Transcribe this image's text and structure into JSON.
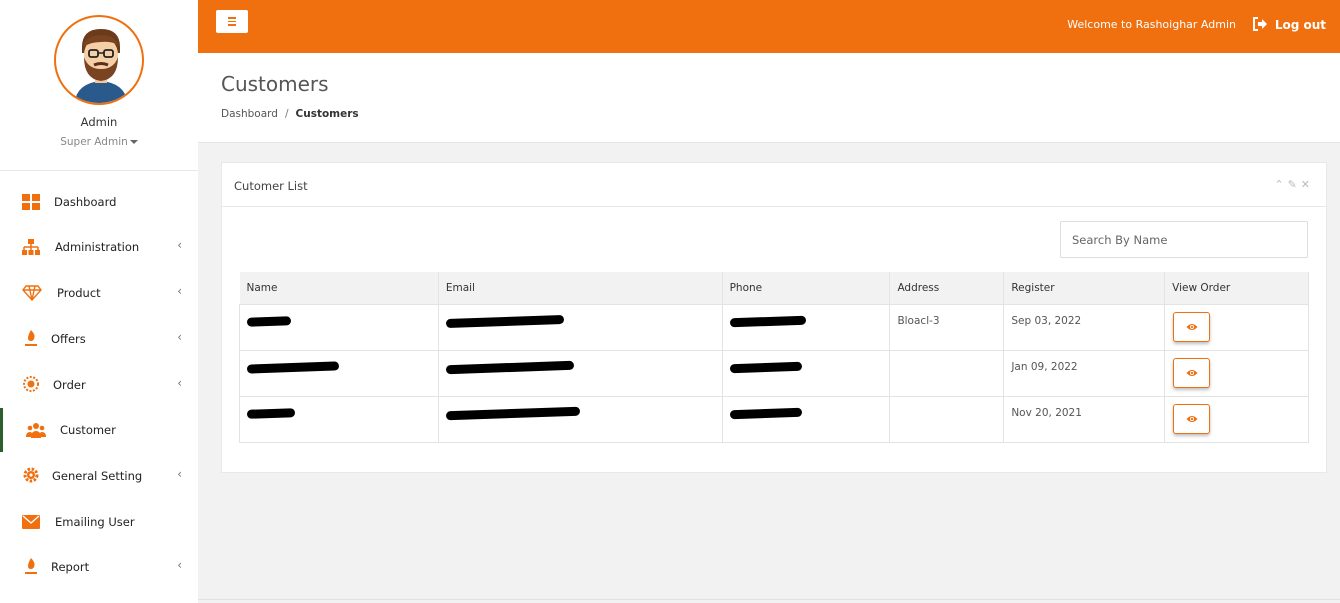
{
  "profile": {
    "name": "Admin",
    "role": "Super Admin"
  },
  "nav": {
    "items": [
      {
        "label": "Dashboard",
        "icon": "dashboard-icon",
        "has_chevron": false
      },
      {
        "label": "Administration",
        "icon": "sitemap-icon",
        "has_chevron": true
      },
      {
        "label": "Product",
        "icon": "diamond-icon",
        "has_chevron": true
      },
      {
        "label": "Offers",
        "icon": "fire-icon",
        "has_chevron": true
      },
      {
        "label": "Order",
        "icon": "burst-icon",
        "has_chevron": true
      },
      {
        "label": "Customer",
        "icon": "users-icon",
        "has_chevron": false,
        "active": true
      },
      {
        "label": "General Setting",
        "icon": "gear-icon",
        "has_chevron": true
      },
      {
        "label": "Emailing User",
        "icon": "envelope-icon",
        "has_chevron": false
      },
      {
        "label": "Report",
        "icon": "fire-icon",
        "has_chevron": true
      }
    ],
    "chevron": "‹"
  },
  "topbar": {
    "welcome": "Welcome to Rashoighar Admin",
    "logout": "Log out"
  },
  "page": {
    "title": "Customers",
    "breadcrumb": {
      "home": "Dashboard",
      "sep": "/",
      "current": "Customers"
    }
  },
  "panel": {
    "title": "Cutomer List",
    "tools": "⌃ ✎ ✕",
    "search_placeholder": "Search By Name",
    "columns": [
      "Name",
      "Email",
      "Phone",
      "Address",
      "Register",
      "View Order"
    ],
    "rows": [
      {
        "address": "Bloacl-3",
        "register": "Sep 03, 2022"
      },
      {
        "address": "",
        "register": "Jan 09, 2022"
      },
      {
        "address": "",
        "register": "Nov 20, 2021"
      }
    ]
  },
  "colors": {
    "accent": "#f07010",
    "active_border": "#2c5e2e"
  }
}
